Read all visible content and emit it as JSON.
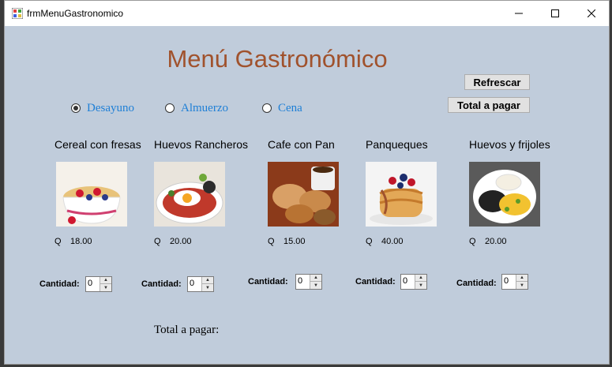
{
  "window": {
    "title": "frmMenuGastronomico"
  },
  "heading": "Menú Gastronómico",
  "buttons": {
    "refresh": "Refrescar",
    "total": "Total a pagar"
  },
  "meals": [
    "Desayuno",
    "Almuerzo",
    "Cena"
  ],
  "selected_meal": "Desayuno",
  "items": [
    {
      "name": "Cereal con fresas",
      "currency": "Q",
      "price": "18.00",
      "qty_label": "Cantidad:",
      "qty": "0"
    },
    {
      "name": "Huevos Rancheros",
      "currency": "Q",
      "price": "20.00",
      "qty_label": "Cantidad:",
      "qty": "0"
    },
    {
      "name": "Cafe con Pan",
      "currency": "Q",
      "price": "15.00",
      "qty_label": "Cantidad:",
      "qty": "0"
    },
    {
      "name": "Panqueques",
      "currency": "Q",
      "price": "40.00",
      "qty_label": "Cantidad:",
      "qty": "0"
    },
    {
      "name": "Huevos y frijoles",
      "currency": "Q",
      "price": "20.00",
      "qty_label": "Cantidad:",
      "qty": "0"
    }
  ],
  "total_label": "Total a pagar:",
  "colors": {
    "heading": "#a0522d",
    "radio_label": "#1e7fd6",
    "form_bg": "#c0ccdb"
  }
}
